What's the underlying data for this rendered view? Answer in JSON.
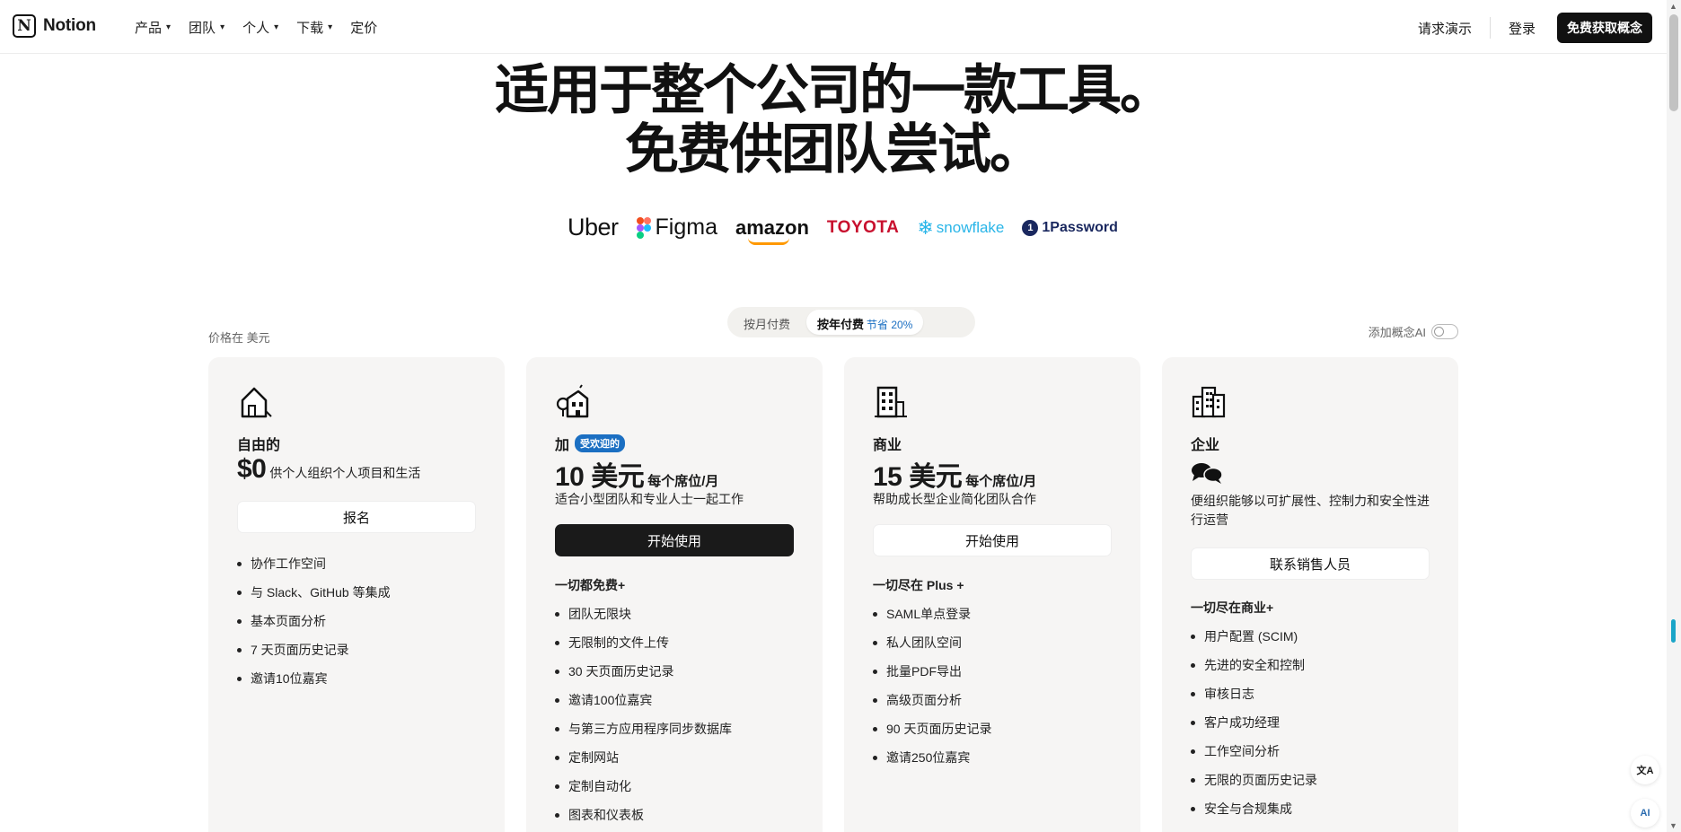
{
  "nav": {
    "logo_text": "Notion",
    "menu": [
      {
        "label": "产品",
        "has_dropdown": true
      },
      {
        "label": "团队",
        "has_dropdown": true
      },
      {
        "label": "个人",
        "has_dropdown": true
      },
      {
        "label": "下载",
        "has_dropdown": true
      },
      {
        "label": "定价",
        "has_dropdown": false
      }
    ],
    "request_demo": "请求演示",
    "login": "登录",
    "cta": "免费获取概念"
  },
  "hero": {
    "line1": "适用于整个公司的一款工具。",
    "line2": "免费供团队尝试。"
  },
  "logos": [
    "Uber",
    "Figma",
    "amazon",
    "TOYOTA",
    "snowflake",
    "1Password"
  ],
  "billing": {
    "monthly": "按月付费",
    "yearly": "按年付费",
    "yearly_save": "节省 20%",
    "selected": "yearly"
  },
  "currency_note": "价格在 美元",
  "ai_toggle": {
    "label": "添加概念AI",
    "enabled": false
  },
  "plans": [
    {
      "name": "自由的",
      "price": "$0",
      "price_unit": "",
      "price_desc": "供个人组织个人项目和生活",
      "description": "",
      "cta": "报名",
      "features_heading": "",
      "features": [
        "协作工作空间",
        "与 Slack、GitHub 等集成",
        "基本页面分析",
        "7 天页面历史记录",
        "邀请10位嘉宾"
      ]
    },
    {
      "name": "加",
      "badge": "受欢迎的",
      "price": "10 美元",
      "price_unit": "每个席位/月",
      "description": "适合小型团队和专业人士一起工作",
      "cta": "开始使用",
      "features_heading": "一切都免费+",
      "features": [
        "团队无限块",
        "无限制的文件上传",
        "30 天页面历史记录",
        "邀请100位嘉宾",
        "与第三方应用程序同步数据库",
        "定制网站",
        "定制自动化",
        "图表和仪表板"
      ]
    },
    {
      "name": "商业",
      "price": "15 美元",
      "price_unit": "每个席位/月",
      "description": "帮助成长型企业简化团队合作",
      "cta": "开始使用",
      "features_heading": "一切尽在 Plus +",
      "features": [
        "SAML单点登录",
        "私人团队空间",
        "批量PDF导出",
        "高级页面分析",
        "90 天页面历史记录",
        "邀请250位嘉宾"
      ]
    },
    {
      "name": "企业",
      "description": "便组织能够以可扩展性、控制力和安全性进行运营",
      "cta": "联系销售人员",
      "features_heading": "一切尽在商业+",
      "features": [
        "用户配置 (SCIM)",
        "先进的安全和控制",
        "审核日志",
        "客户成功经理",
        "工作空间分析",
        "无限的页面历史记录",
        "安全与合规集成"
      ]
    }
  ],
  "float_buttons": {
    "translate": "文A",
    "assistant": "AI"
  },
  "colors": {
    "accent_blue": "#1b6fc2",
    "cta_dark": "#1a1a1a",
    "card_bg": "#f6f5f4",
    "toyota_red": "#c8102e",
    "snowflake_blue": "#29b5e8"
  }
}
